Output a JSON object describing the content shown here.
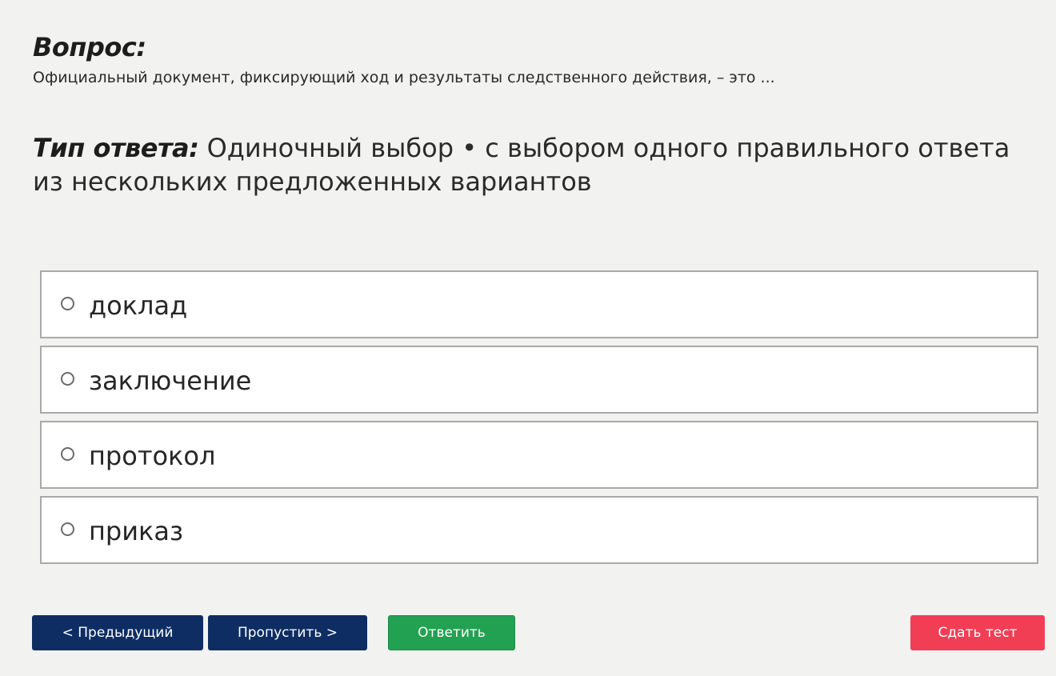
{
  "question": {
    "heading": "Вопрос:",
    "text": "Официальный документ, фиксирующий ход и результаты следственного действия, – это ..."
  },
  "answer_type": {
    "label": "Тип ответа:",
    "value": "Одиночный выбор • с выбором одного правильного ответа из нескольких предложенных вариантов"
  },
  "options": [
    {
      "label": "доклад",
      "selected": false
    },
    {
      "label": "заключение",
      "selected": false
    },
    {
      "label": "протокол",
      "selected": false
    },
    {
      "label": "приказ",
      "selected": false
    }
  ],
  "buttons": {
    "prev": "< Предыдущий",
    "skip": "Пропустить >",
    "answer": "Ответить",
    "submit": "Сдать тест"
  },
  "colors": {
    "background": "#f2f2f1",
    "nav_button": "#0e2d63",
    "answer_button": "#23a152",
    "submit_button": "#f13e55"
  }
}
